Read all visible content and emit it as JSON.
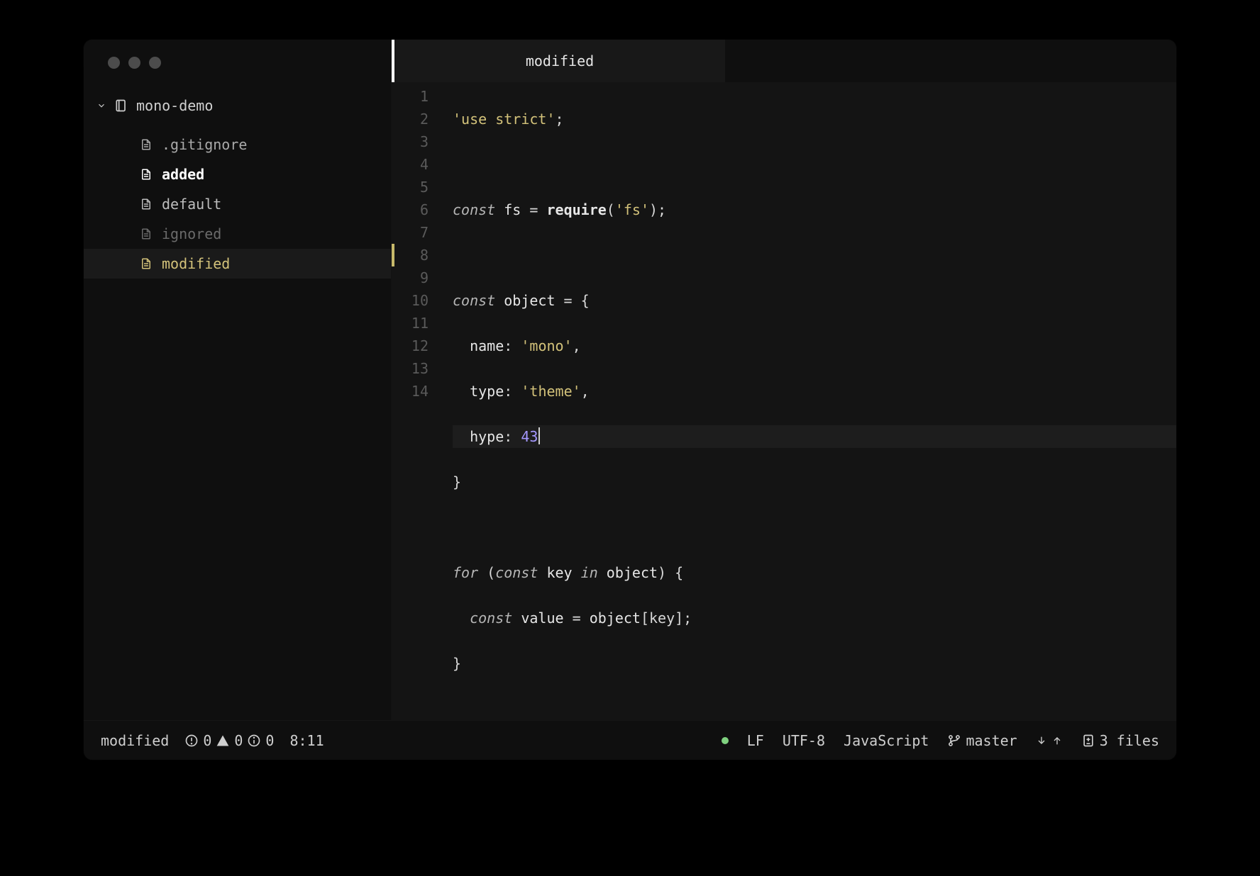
{
  "window": {
    "title": "modified"
  },
  "sidebar": {
    "project_name": "mono-demo",
    "items": [
      {
        "name": ".gitignore",
        "status": "gitignore"
      },
      {
        "name": "added",
        "status": "added"
      },
      {
        "name": "default",
        "status": "default"
      },
      {
        "name": "ignored",
        "status": "ignored"
      },
      {
        "name": "modified",
        "status": "modified",
        "selected": true
      }
    ]
  },
  "tab": {
    "label": "modified"
  },
  "editor": {
    "line_count": 14,
    "modified_line": 8,
    "cursor_after": "43"
  },
  "code": {
    "l1_str": "'use strict'",
    "l3_kw": "const",
    "l3_id": "fs",
    "l3_eq": " = ",
    "l3_fn": "require",
    "l3_open": "(",
    "l3_arg": "'fs'",
    "l3_close": ");",
    "l5_kw": "const",
    "l5_id": " object ",
    "l5_eq": "= ",
    "l5_brace": "{",
    "l6_key": "name",
    "l6_val": "'mono'",
    "l7_key": "type",
    "l7_val": "'theme'",
    "l8_key": "hype",
    "l8_val": "43",
    "l9_brace": "}",
    "l11_for": "for",
    "l11_open": " (",
    "l11_const": "const",
    "l11_key": " key ",
    "l11_in": "in",
    "l11_obj": " object",
    "l11_close": ") {",
    "l12_const": "const",
    "l12_val": " value ",
    "l12_eq": "= ",
    "l12_obj": "object",
    "l12_br": "[key];",
    "l13_brace": "}"
  },
  "status": {
    "left": {
      "filename": "modified",
      "errors": "0",
      "warnings": "0",
      "info": "0",
      "cursor": "8:11"
    },
    "right": {
      "eol": "LF",
      "encoding": "UTF-8",
      "language": "JavaScript",
      "branch": "master",
      "diff_files": "3 files"
    }
  }
}
